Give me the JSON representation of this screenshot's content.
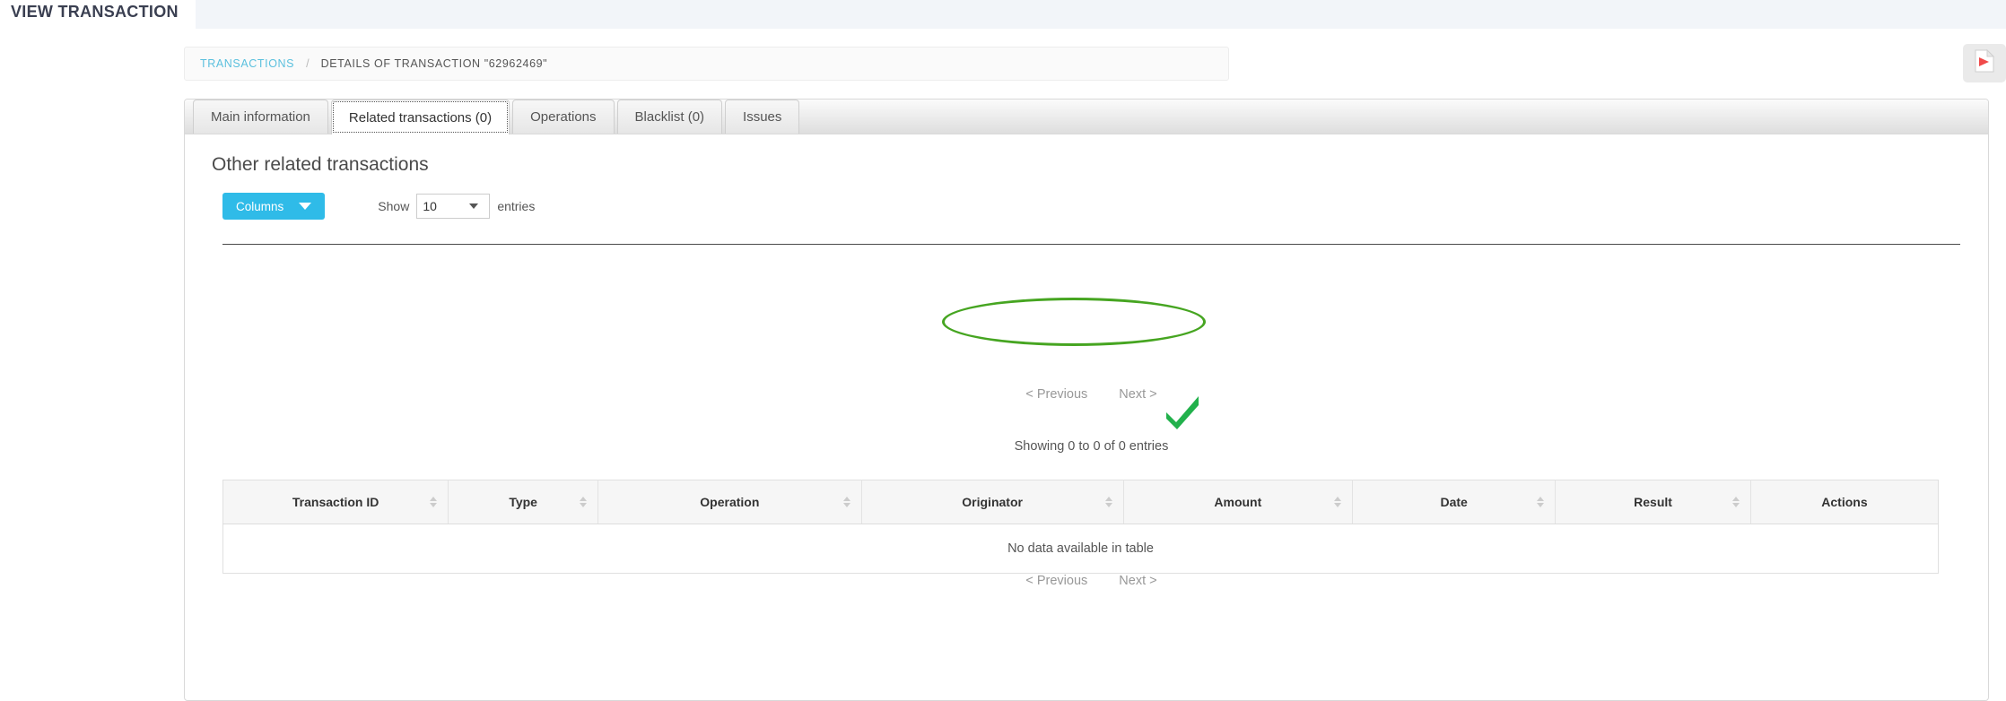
{
  "header": {
    "title": "VIEW TRANSACTION"
  },
  "breadcrumb": {
    "root_label": "TRANSACTIONS",
    "separator": "/",
    "current_label": "DETAILS OF TRANSACTION \"62962469\""
  },
  "actions": {
    "pdf_export_icon": "pdf-export-icon"
  },
  "tabs": [
    {
      "label": "Main information",
      "active": false
    },
    {
      "label": "Related transactions (0)",
      "active": true
    },
    {
      "label": "Operations",
      "active": false
    },
    {
      "label": "Blacklist (0)",
      "active": false
    },
    {
      "label": "Issues",
      "active": false
    }
  ],
  "section": {
    "title": "Other related transactions"
  },
  "toolbar": {
    "columns_label": "Columns",
    "columns_caret_icon": "chevron-down-icon",
    "columns_button_color": "#2fbbe8",
    "show_label": "Show",
    "entries_value": "10",
    "entries_caret_icon": "chevron-down-icon",
    "entries_label": "entries"
  },
  "pagination": {
    "previous_label": "< Previous",
    "next_label": "Next >"
  },
  "status": {
    "showing_text": "Showing 0 to 0 of 0 entries"
  },
  "table": {
    "columns": [
      {
        "label": "Transaction ID",
        "sortable": true
      },
      {
        "label": "Type",
        "sortable": true
      },
      {
        "label": "Operation",
        "sortable": true
      },
      {
        "label": "Originator",
        "sortable": true
      },
      {
        "label": "Amount",
        "sortable": true
      },
      {
        "label": "Date",
        "sortable": true
      },
      {
        "label": "Result",
        "sortable": true
      },
      {
        "label": "Actions",
        "sortable": false
      }
    ],
    "rows": [],
    "empty_message": "No data available in table"
  },
  "annotations": {
    "highlight_color": "#46a521",
    "ellipse_target": "showing-info",
    "check_target": "empty-row-message"
  }
}
